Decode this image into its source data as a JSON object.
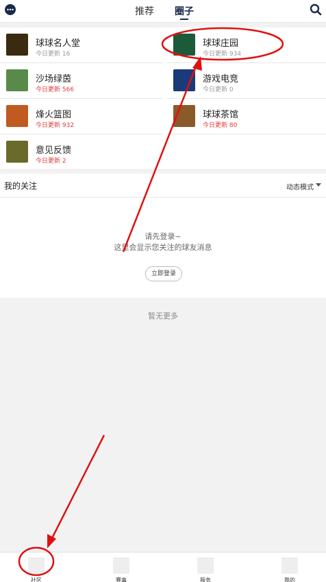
{
  "topbar": {
    "tabs": [
      {
        "label": "推荐"
      },
      {
        "label": "圈子"
      }
    ]
  },
  "circles": [
    {
      "name": "球球名人堂",
      "update": "今日更新 16",
      "highlight": false,
      "thumb_color": "#3a2a10"
    },
    {
      "name": "球球庄园",
      "update": "今日更新 934",
      "highlight": false,
      "thumb_color": "#1d5a3a"
    },
    {
      "name": "沙场绿茵",
      "update": "今日更新 566",
      "highlight": true,
      "thumb_color": "#5a8a4a"
    },
    {
      "name": "游戏电竞",
      "update": "今日更新 0",
      "highlight": false,
      "thumb_color": "#1a3a7a"
    },
    {
      "name": "烽火篮图",
      "update": "今日更新 932",
      "highlight": true,
      "thumb_color": "#c05a20"
    },
    {
      "name": "球球茶馆",
      "update": "今日更新 80",
      "highlight": true,
      "thumb_color": "#8a5a2a"
    },
    {
      "name": "意见反馈",
      "update": "今日更新 2",
      "highlight": true,
      "thumb_color": "#6a6a2a"
    }
  ],
  "follow": {
    "title": "我的关注",
    "mode": "动态模式",
    "tip_line1": "请先登录~",
    "tip_line2": "这里会显示您关注的球友消息",
    "login_button": "立即登录"
  },
  "no_more": "暂无更多",
  "bottom_nav": [
    {
      "label": "社区"
    },
    {
      "label": "赛事"
    },
    {
      "label": "服务"
    },
    {
      "label": "我的"
    }
  ],
  "colors": {
    "accent": "#1a2a4a",
    "highlight_red": "#e03b3b",
    "annotation_red": "#e01010"
  }
}
